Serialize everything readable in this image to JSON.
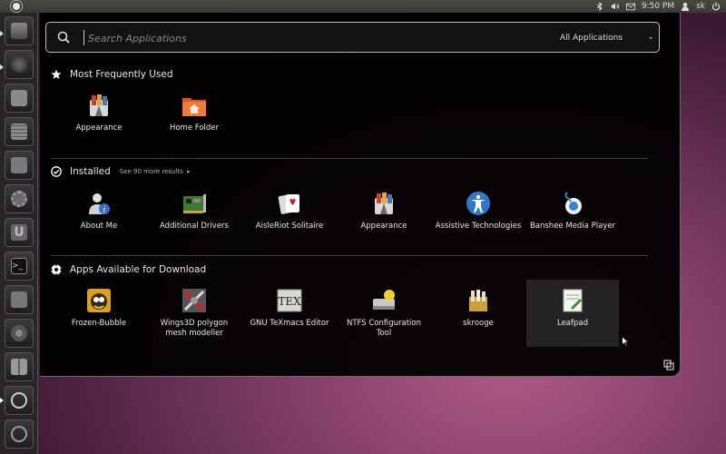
{
  "top_panel": {
    "time": "9:50 PM",
    "user": "sk",
    "icons": [
      "bluetooth-icon",
      "volume-icon",
      "mail-icon",
      "user-icon",
      "power-icon"
    ]
  },
  "launcher": {
    "items": [
      "home-folder-icon",
      "firefox-icon",
      "writer-icon",
      "calc-icon",
      "impress-icon",
      "settings-icon",
      "ubuntu-one-icon",
      "terminal-icon",
      "screenshot-icon",
      "chromium-icon",
      "workspaces-icon",
      "apps-lens-icon",
      "files-lens-icon"
    ]
  },
  "search": {
    "placeholder": "Search Applications",
    "scope": "All Applications"
  },
  "sections": {
    "frequent": {
      "title": "Most Frequently Used",
      "apps": [
        {
          "name": "Appearance",
          "icon": "appearance-icon"
        },
        {
          "name": "Home Folder",
          "icon": "home-folder-icon"
        }
      ]
    },
    "installed": {
      "title": "Installed",
      "see_more": "See 90 more results",
      "apps": [
        {
          "name": "About Me",
          "icon": "about-me-icon"
        },
        {
          "name": "Additional Drivers",
          "icon": "drivers-icon"
        },
        {
          "name": "AisleRiot Solitaire",
          "icon": "solitaire-icon"
        },
        {
          "name": "Appearance",
          "icon": "appearance-icon"
        },
        {
          "name": "Assistive Technologies",
          "icon": "accessibility-icon"
        },
        {
          "name": "Banshee Media Player",
          "icon": "banshee-icon"
        }
      ]
    },
    "download": {
      "title": "Apps Available for Download",
      "apps": [
        {
          "name": "Frozen-Bubble",
          "icon": "frozen-bubble-icon"
        },
        {
          "name": "Wings3D polygon mesh modeller",
          "icon": "wings3d-icon"
        },
        {
          "name": "GNU TeXmacs Editor",
          "icon": "texmacs-icon"
        },
        {
          "name": "NTFS Configuration Tool",
          "icon": "ntfs-config-icon"
        },
        {
          "name": "skrooge",
          "icon": "skrooge-icon"
        },
        {
          "name": "Leafpad",
          "icon": "leafpad-icon"
        }
      ]
    }
  },
  "colors": {
    "dash_bg": "#000000",
    "wallpaper": "#7a3a63",
    "highlight": "#3c3c3c"
  }
}
